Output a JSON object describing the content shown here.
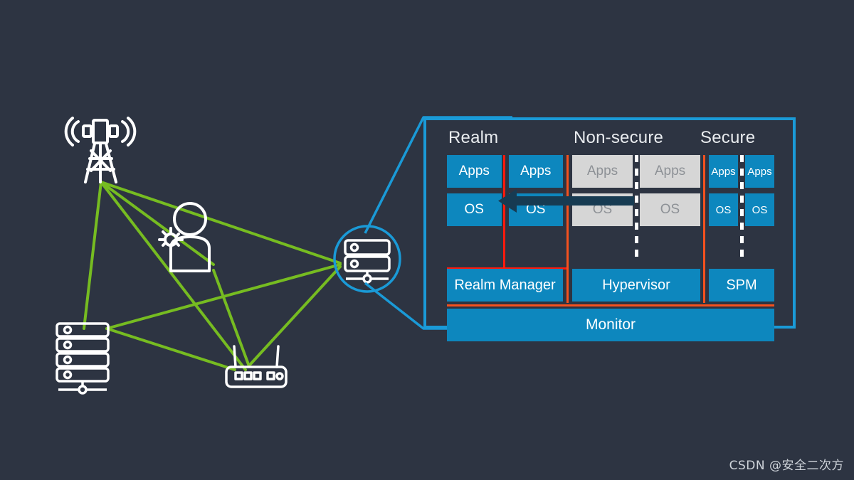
{
  "background_color": "#2d3442",
  "architecture": {
    "panel_border_color": "#1a9ad7",
    "block_blue": "#0d87be",
    "block_grey": "#d6d6d6",
    "separator_red": "#ff1a0d",
    "separator_orange": "#f4511e",
    "arrow_color": "#173b52",
    "headers": {
      "realm": "Realm",
      "non_secure": "Non-secure",
      "secure": "Secure"
    },
    "worlds": [
      {
        "id": "realm",
        "header": "Realm",
        "guests": [
          {
            "apps": "Apps",
            "os": "OS"
          },
          {
            "apps": "Apps",
            "os": "OS"
          }
        ],
        "manager": "Realm Manager"
      },
      {
        "id": "non-secure",
        "header": "Non-secure",
        "guests": [
          {
            "apps": "Apps",
            "os": "OS"
          },
          {
            "apps": "Apps",
            "os": "OS"
          }
        ],
        "manager": "Hypervisor"
      },
      {
        "id": "secure",
        "header": "Secure",
        "guests": [
          {
            "apps": "Apps",
            "os": "OS"
          },
          {
            "apps": "Apps",
            "os": "OS"
          }
        ],
        "manager": "SPM"
      }
    ],
    "monitor": "Monitor"
  },
  "network": {
    "line_color": "#76bc21",
    "icon_color": "#ffffff",
    "highlight_circle_color": "#1a9ad7",
    "nodes": [
      {
        "name": "cell-tower",
        "label": ""
      },
      {
        "name": "user-with-gear",
        "label": ""
      },
      {
        "name": "server-rack",
        "label": ""
      },
      {
        "name": "router",
        "label": ""
      },
      {
        "name": "highlighted-server",
        "label": ""
      }
    ]
  },
  "watermark": "CSDN @安全二次方"
}
